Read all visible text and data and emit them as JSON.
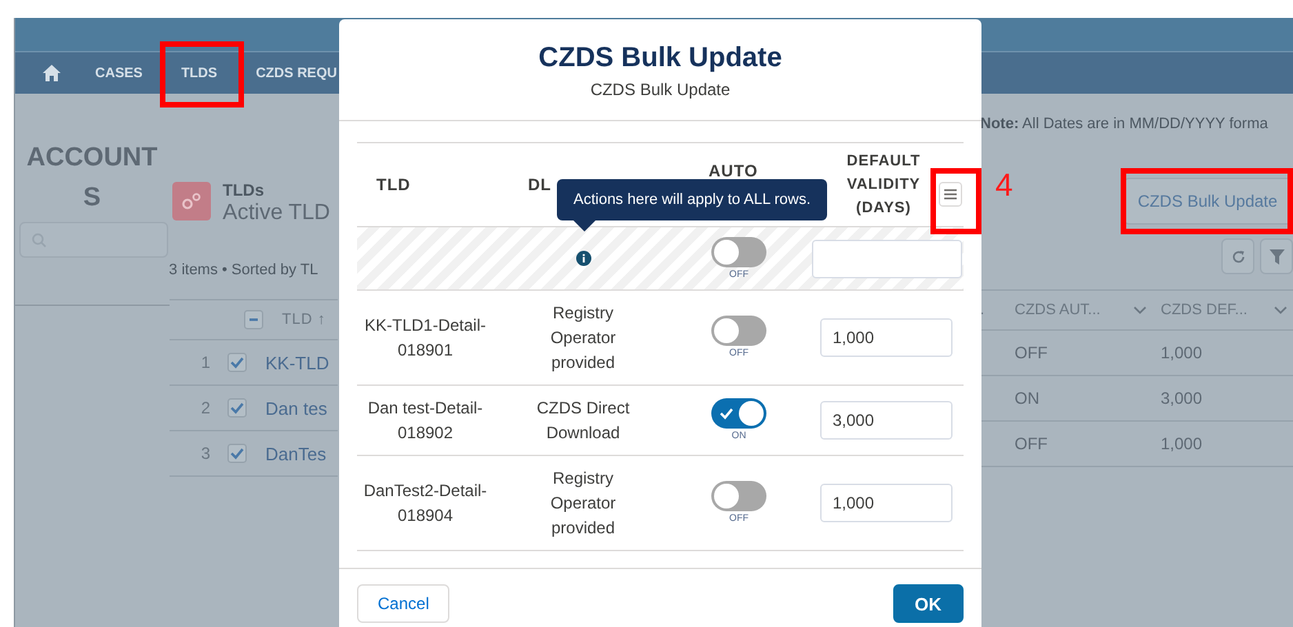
{
  "nav": {
    "items": [
      {
        "label": "CASES"
      },
      {
        "label": "TLDS"
      },
      {
        "label": "CZDS REQU"
      }
    ]
  },
  "sidebar": {
    "title": "ACCOUNTS"
  },
  "list_view": {
    "object": "TLDs",
    "title": "Active TLD",
    "summary": "3 items • Sorted by TL",
    "note": "**Note:** All Dates are in MM/DD/YYYY forma",
    "action_button": "CZDS Bulk Update",
    "select_all_indeterminate": true,
    "left_column": "TLD ↑",
    "right_columns": [
      ".",
      "CZDS AUT...",
      "CZDS DEF..."
    ],
    "rows": [
      {
        "number": "1",
        "checked": true,
        "tld": "KK-TLD",
        "auto": "OFF",
        "validity": "1,000"
      },
      {
        "number": "2",
        "checked": true,
        "tld": "Dan tes",
        "auto": "ON",
        "validity": "3,000"
      },
      {
        "number": "3",
        "checked": true,
        "tld": "DanTes",
        "auto": "OFF",
        "validity": "1,000"
      }
    ]
  },
  "modal": {
    "title": "CZDS Bulk Update",
    "subtitle": "CZDS Bulk Update",
    "columns": [
      "TLD",
      "DL",
      "AUTO",
      "DEFAULT VALIDITY (DAYS)"
    ],
    "tooltip": "Actions here will apply to ALL rows.",
    "bulk_row": {
      "auto_on": false,
      "toggle_label": "OFF"
    },
    "rows": [
      {
        "tld": "KK-TLD1-Detail-018901",
        "dl_method": "Registry Operator provided",
        "auto_on": false,
        "toggle_label": "OFF",
        "validity": "1,000"
      },
      {
        "tld": "Dan test-Detail-018902",
        "dl_method": "CZDS Direct Download",
        "auto_on": true,
        "toggle_label": "ON",
        "validity": "3,000"
      },
      {
        "tld": "DanTest2-Detail-018904",
        "dl_method": "Registry Operator provided",
        "auto_on": false,
        "toggle_label": "OFF",
        "validity": "1,000"
      }
    ],
    "cancel_button": "Cancel",
    "ok_button": "OK"
  },
  "annotation": {
    "step_number": "4"
  }
}
